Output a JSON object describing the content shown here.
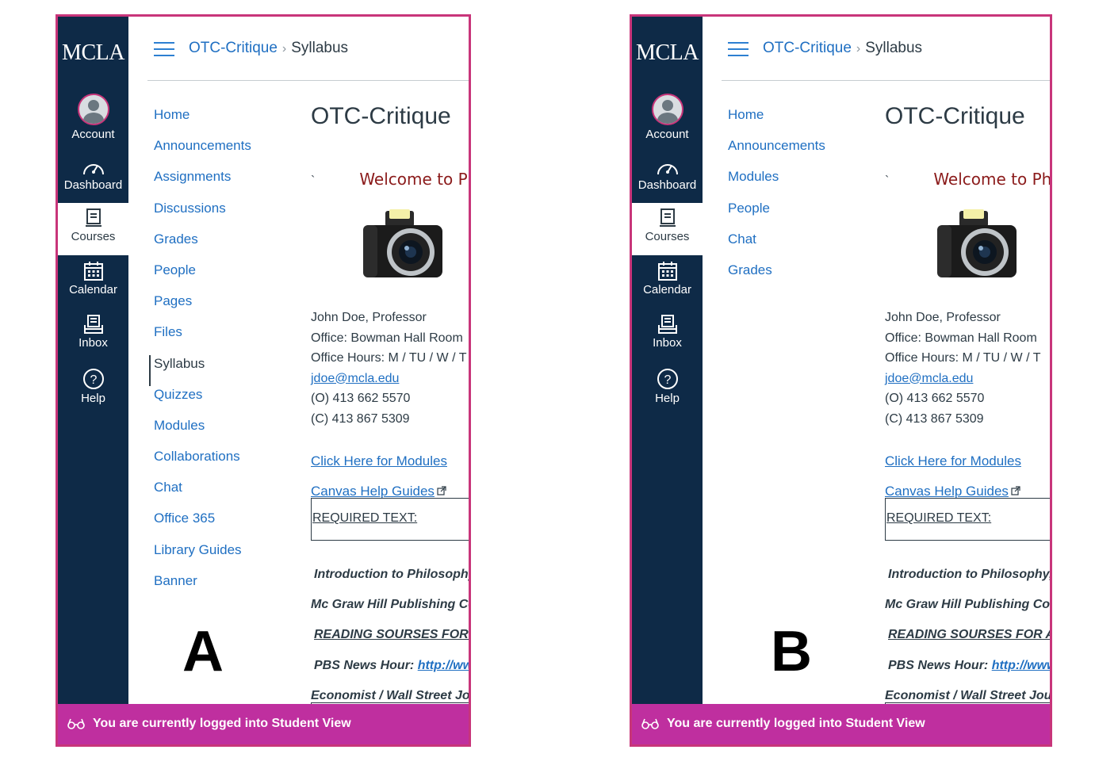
{
  "panels": [
    {
      "letter": "A",
      "logo": "MCLA",
      "global_nav": [
        {
          "label": "Account",
          "icon": "account-avatar-icon"
        },
        {
          "label": "Dashboard",
          "icon": "speedometer-icon"
        },
        {
          "label": "Courses",
          "icon": "book-icon"
        },
        {
          "label": "Calendar",
          "icon": "calendar-icon"
        },
        {
          "label": "Inbox",
          "icon": "inbox-icon"
        },
        {
          "label": "Help",
          "icon": "help-icon"
        }
      ],
      "breadcrumb": {
        "course": "OTC-Critique",
        "sep": "›",
        "page": "Syllabus"
      },
      "course_nav": [
        "Home",
        "Announcements",
        "Assignments",
        "Discussions",
        "Grades",
        "People",
        "Pages",
        "Files",
        "Syllabus",
        "Quizzes",
        "Modules",
        "Collaborations",
        "Chat",
        "Office 365",
        "Library Guides",
        "Banner"
      ],
      "course_nav_active": "Syllabus",
      "content": {
        "title": "OTC-Critique",
        "tick": "`",
        "welcome": "Welcome to Ph",
        "professor": "John Doe, Professor",
        "office": "Office: Bowman Hall Room",
        "hours": "Office Hours: M / TU / W / T",
        "email": "jdoe@mcla.edu",
        "office_phone": "(O) 413 662 5570",
        "cell_phone": "(C) 413 867 5309",
        "modules_link": "Click Here for Modules",
        "help_link": "Canvas Help Guides",
        "required_text": "REQUIRED TEXT:",
        "book": "Introduction to Philosophy, C",
        "publisher": "Mc Graw Hill Publishing Com",
        "reading": "READING SOURSES FOR AR",
        "pbs_label": "PBS News Hour:",
        "pbs_link": "http://www.",
        "economist": "Economist / Wall Street Journ"
      },
      "banner": "You are currently logged into Student View"
    },
    {
      "letter": "B",
      "logo": "MCLA",
      "global_nav": [
        {
          "label": "Account",
          "icon": "account-avatar-icon"
        },
        {
          "label": "Dashboard",
          "icon": "speedometer-icon"
        },
        {
          "label": "Courses",
          "icon": "book-icon"
        },
        {
          "label": "Calendar",
          "icon": "calendar-icon"
        },
        {
          "label": "Inbox",
          "icon": "inbox-icon"
        },
        {
          "label": "Help",
          "icon": "help-icon"
        }
      ],
      "breadcrumb": {
        "course": "OTC-Critique",
        "sep": "›",
        "page": "Syllabus"
      },
      "course_nav": [
        "Home",
        "Announcements",
        "Modules",
        "People",
        "Chat",
        "Grades"
      ],
      "course_nav_active": "",
      "content": {
        "title": "OTC-Critique",
        "tick": "`",
        "welcome": "Welcome to Ph",
        "professor": "John Doe, Professor",
        "office": "Office: Bowman Hall Room",
        "hours": "Office Hours: M / TU / W / T",
        "email": "jdoe@mcla.edu",
        "office_phone": "(O) 413 662 5570",
        "cell_phone": "(C) 413 867 5309",
        "modules_link": "Click Here for Modules",
        "help_link": "Canvas Help Guides",
        "required_text": "REQUIRED TEXT:",
        "book": "Introduction to Philosophy, C",
        "publisher": "Mc Graw Hill Publishing Com",
        "reading": "READING SOURSES FOR AR",
        "pbs_label": "PBS News Hour:",
        "pbs_link": "http://www.",
        "economist": "Economist / Wall Street Journ"
      },
      "banner": "You are currently logged into Student View"
    }
  ],
  "colors": {
    "rail": "#0e2a47",
    "link": "#1f6fc2",
    "banner": "#bf2f9f",
    "border": "#c8357a",
    "welcome": "#8b1b1b"
  }
}
